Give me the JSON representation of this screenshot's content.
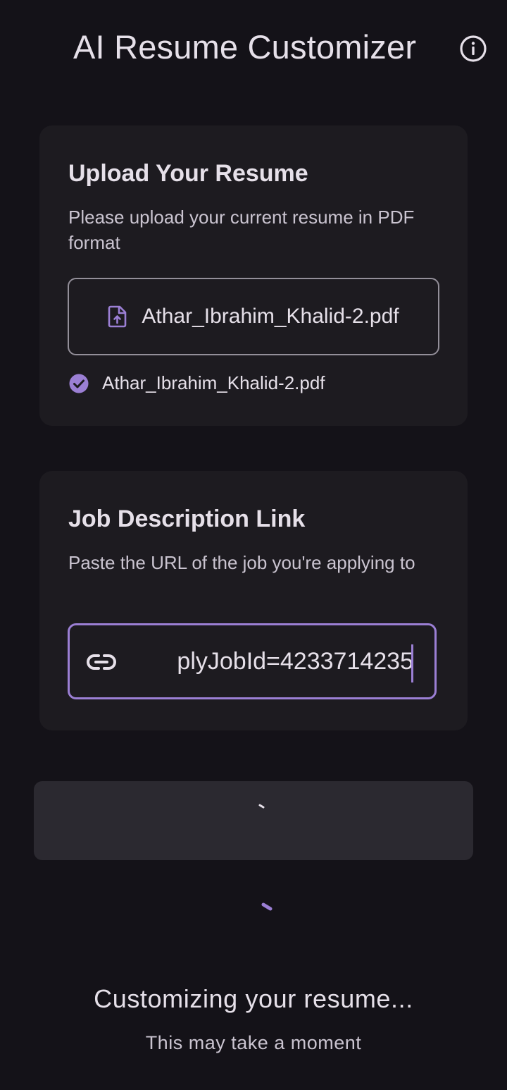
{
  "header": {
    "title": "AI Resume Customizer",
    "info_icon": "info-icon"
  },
  "upload_card": {
    "title": "Upload Your Resume",
    "subtitle": "Please upload your current resume in PDF format",
    "upload_button_icon": "file-upload-icon",
    "upload_button_label": "Athar_Ibrahim_Khalid-2.pdf",
    "selected_file_icon": "check-circle-icon",
    "selected_file_name": "Athar_Ibrahim_Khalid-2.pdf"
  },
  "job_card": {
    "title": "Job Description Link",
    "subtitle": "Paste the URL of the job you're applying to",
    "url_icon": "link-icon",
    "url_value": "plyJobId=4233714235"
  },
  "submit_button": {
    "state": "loading",
    "icon": "progress-spinner-icon"
  },
  "status": {
    "title": "Customizing your resume...",
    "subtitle": "This may take a moment"
  },
  "colors": {
    "background": "#141218",
    "card": "#1d1b20",
    "accent": "#9b7fd4",
    "button_surface": "#2b2930",
    "text_primary": "#e6e0e9",
    "text_secondary": "#cac4d0",
    "outline": "#938f99"
  }
}
